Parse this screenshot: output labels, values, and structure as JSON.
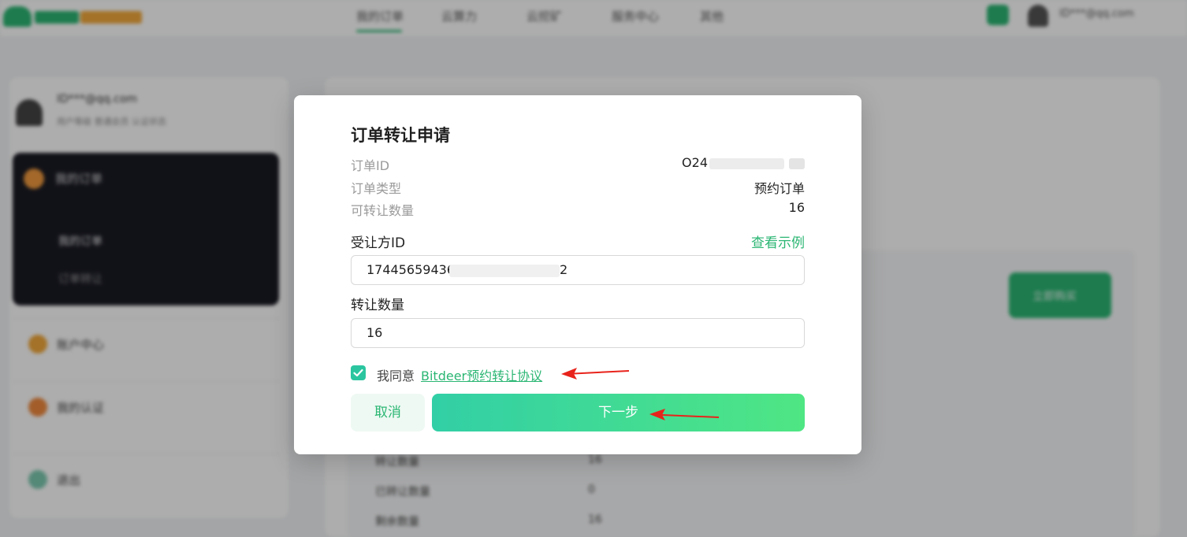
{
  "background": {
    "nav": [
      "我的订单",
      "云算力",
      "云挖矿",
      "服务中心",
      "其他"
    ],
    "user_label": "ID***@qq.com",
    "sidebar": {
      "email": "ID***@qq.com",
      "sub": "用户等级 普通会员 认证状态",
      "active_menu": "我的订单",
      "submenu": [
        "我的订单",
        "订单转让"
      ],
      "items": [
        "账户中心",
        "我的认证",
        "退出"
      ]
    },
    "main": {
      "button": "立即购买",
      "rows": [
        {
          "k": "转让数量",
          "v": "16"
        },
        {
          "k": "已转让数量",
          "v": "0"
        },
        {
          "k": "剩余数量",
          "v": "16"
        }
      ]
    }
  },
  "modal": {
    "title": "订单转让申请",
    "info": [
      {
        "label": "订单ID",
        "value": "O24"
      },
      {
        "label": "订单类型",
        "value": "预约订单"
      },
      {
        "label": "可转让数量",
        "value": "16"
      }
    ],
    "recipient_label": "受让方ID",
    "example_link": "查看示例",
    "recipient_value": "174456594363",
    "recipient_tail": "2",
    "quantity_label": "转让数量",
    "quantity_value": "16",
    "agree_checked": true,
    "agree_text": "我同意",
    "agree_link": "Bitdeer预约转让协议",
    "cancel_label": "取消",
    "next_label": "下一步"
  },
  "colors": {
    "accent": "#2bb673",
    "gradient_start": "#32cfa6",
    "gradient_end": "#4fe684",
    "annotation_arrow": "#e8231b"
  }
}
